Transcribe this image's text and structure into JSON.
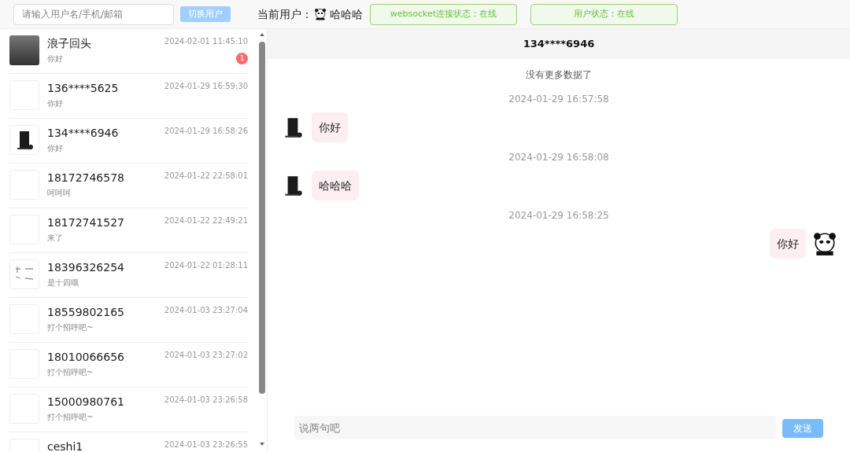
{
  "top_bar": {
    "search": {
      "placeholder": "请输入用户名/手机/邮箱"
    },
    "switch_button": "切换用户",
    "current_user_label": "当前用户：",
    "current_user_name": "哈哈哈",
    "statuses": [
      "websocket连接状态：在线",
      "用户状态：在线"
    ]
  },
  "contacts": [
    {
      "name": "浪子回头",
      "time": "2024-02-01 11:45:10",
      "preview": "你好",
      "kind": "photo",
      "unread": "1"
    },
    {
      "name": "136****5625",
      "time": "2024-01-29 16:59:30",
      "preview": "你好",
      "kind": "blank"
    },
    {
      "name": "134****6946",
      "time": "2024-01-29 16:58:26",
      "preview": "你好",
      "kind": "console"
    },
    {
      "name": "18172746578",
      "time": "2024-01-22 22:58:01",
      "preview": "呵呵呵",
      "kind": "blank"
    },
    {
      "name": "18172741527",
      "time": "2024-01-22 22:49:21",
      "preview": "来了",
      "kind": "blank"
    },
    {
      "name": "18396326254",
      "time": "2024-01-22 01:28:11",
      "preview": "是十四哦",
      "kind": "sketch"
    },
    {
      "name": "18559802165",
      "time": "2024-01-03 23:27:04",
      "preview": "打个招呼吧~",
      "kind": "blank"
    },
    {
      "name": "18010066656",
      "time": "2024-01-03 23:27:02",
      "preview": "打个招呼吧~",
      "kind": "blank"
    },
    {
      "name": "15000980761",
      "time": "2024-01-03 23:26:58",
      "preview": "打个招呼吧~",
      "kind": "blank"
    },
    {
      "name": "ceshi1",
      "time": "2024-01-03 23:26:55",
      "kind": "blank"
    }
  ],
  "chat": {
    "title": "134****6946",
    "no_more": "没有更多数据了",
    "messages": [
      {
        "time": "2024-01-29 16:57:58",
        "text": "你好",
        "kind": "received"
      },
      {
        "time": "2024-01-29 16:58:08",
        "text": "哈哈哈",
        "kind": "received"
      },
      {
        "time": "2024-01-29 16:58:25",
        "text": "你好",
        "kind": "sent"
      }
    ],
    "input": {
      "placeholder": "说两句吧"
    },
    "send_button": "发送"
  }
}
